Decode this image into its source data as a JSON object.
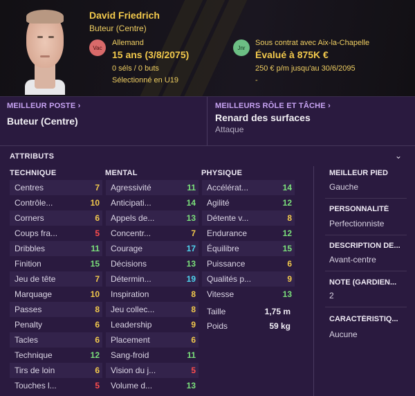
{
  "player": {
    "name": "David Friedrich",
    "role": "Buteur (Centre)",
    "badge_left": "Vac",
    "nationality": "Allemand",
    "age": "15 ans (3/8/2075)",
    "caps": "0 séls / 0 buts",
    "selection": "Sélectionné en U19",
    "badge_right": "Jnr",
    "contract": "Sous contrat avec Aix-la-Chapelle",
    "value": "Évalué à 875K €",
    "wage": "250 € p/m jusqu'au 30/6/2095",
    "extra": "-"
  },
  "best_position": {
    "label": "MEILLEUR POSTE ›",
    "value": "Buteur (Centre)"
  },
  "best_role": {
    "label": "MEILLEURS RÔLE ET TÂCHE ›",
    "value": "Renard des surfaces",
    "duty": "Attaque"
  },
  "attributes": {
    "title": "ATTRIBUTS",
    "chevron": "⌄",
    "technique": {
      "header": "TECHNIQUE",
      "items": [
        {
          "name": "Centres",
          "value": "7"
        },
        {
          "name": "Contrôle...",
          "value": "10"
        },
        {
          "name": "Corners",
          "value": "6"
        },
        {
          "name": "Coups fra...",
          "value": "5"
        },
        {
          "name": "Dribbles",
          "value": "11"
        },
        {
          "name": "Finition",
          "value": "15"
        },
        {
          "name": "Jeu de tête",
          "value": "7"
        },
        {
          "name": "Marquage",
          "value": "10"
        },
        {
          "name": "Passes",
          "value": "8"
        },
        {
          "name": "Penalty",
          "value": "6"
        },
        {
          "name": "Tacles",
          "value": "6"
        },
        {
          "name": "Technique",
          "value": "12"
        },
        {
          "name": "Tirs de loin",
          "value": "6"
        },
        {
          "name": "Touches l...",
          "value": "5"
        }
      ]
    },
    "mental": {
      "header": "MENTAL",
      "items": [
        {
          "name": "Agressivité",
          "value": "11"
        },
        {
          "name": "Anticipati...",
          "value": "14"
        },
        {
          "name": "Appels de...",
          "value": "13"
        },
        {
          "name": "Concentr...",
          "value": "7"
        },
        {
          "name": "Courage",
          "value": "17"
        },
        {
          "name": "Décisions",
          "value": "13"
        },
        {
          "name": "Détermin...",
          "value": "19"
        },
        {
          "name": "Inspiration",
          "value": "8"
        },
        {
          "name": "Jeu collec...",
          "value": "8"
        },
        {
          "name": "Leadership",
          "value": "9"
        },
        {
          "name": "Placement",
          "value": "6"
        },
        {
          "name": "Sang-froid",
          "value": "11"
        },
        {
          "name": "Vision du j...",
          "value": "5"
        },
        {
          "name": "Volume d...",
          "value": "13"
        }
      ]
    },
    "physique": {
      "header": "PHYSIQUE",
      "items": [
        {
          "name": "Accélérat...",
          "value": "14"
        },
        {
          "name": "Agilité",
          "value": "12"
        },
        {
          "name": "Détente v...",
          "value": "8"
        },
        {
          "name": "Endurance",
          "value": "12"
        },
        {
          "name": "Équilibre",
          "value": "15"
        },
        {
          "name": "Puissance",
          "value": "6"
        },
        {
          "name": "Qualités p...",
          "value": "9"
        },
        {
          "name": "Vitesse",
          "value": "13"
        }
      ],
      "height_label": "Taille",
      "height_value": "1,75 m",
      "weight_label": "Poids",
      "weight_value": "59 kg"
    }
  },
  "side": [
    {
      "label": "MEILLEUR PIED",
      "value": "Gauche"
    },
    {
      "label": "PERSONNALITÉ",
      "value": "Perfectionniste"
    },
    {
      "label": "DESCRIPTION DE...",
      "value": "Avant-centre"
    },
    {
      "label": "NOTE (GARDIEN...",
      "value": "2"
    },
    {
      "label": "CARACTÉRISTIQ...",
      "value": "Aucune"
    }
  ],
  "colors": {
    "gold": "#f2c94c",
    "accent": "#c9a5f5",
    "attr_low": "#ff4d4d",
    "attr_mid": "#f2c94c",
    "attr_good": "#7be07b",
    "attr_high": "#4fd6f0"
  }
}
